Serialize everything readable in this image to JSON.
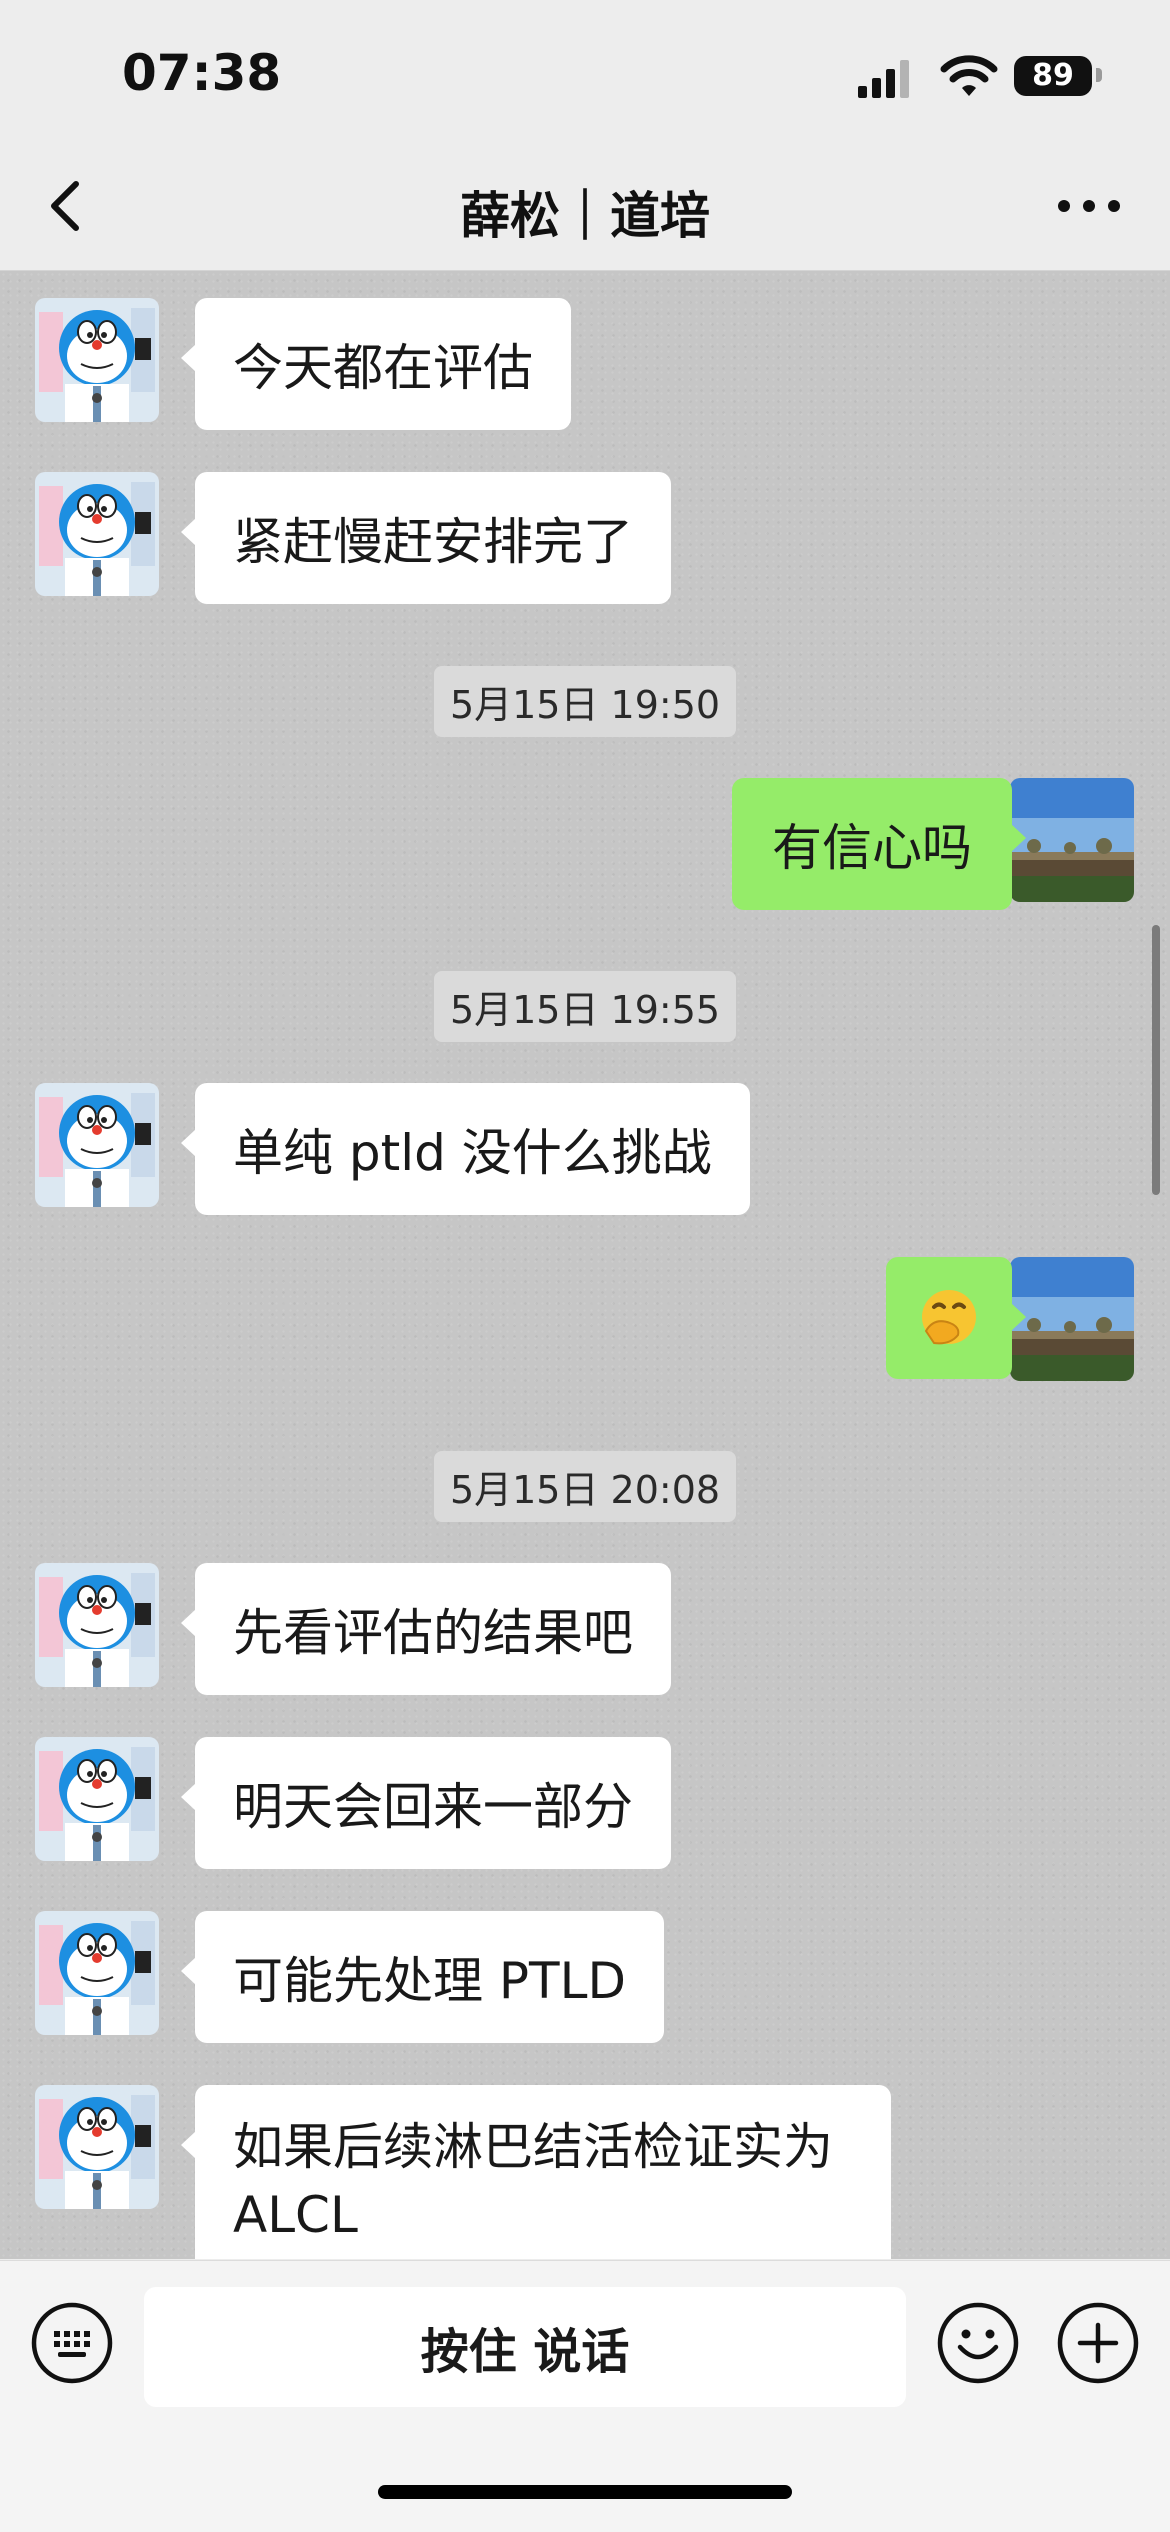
{
  "status_bar": {
    "time": "07:38",
    "battery": "89",
    "icons": [
      "signal-icon",
      "wifi-icon",
      "battery-icon"
    ]
  },
  "nav": {
    "title": "薛松｜道培",
    "back_icon": "chevron-left-icon",
    "more_icon": "more-dots-icon"
  },
  "messages": [
    {
      "type": "incoming",
      "text": "今天都在评估"
    },
    {
      "type": "incoming",
      "text": "紧赶慢赶安排完了"
    },
    {
      "type": "timestamp",
      "text": "5月15日 19:50"
    },
    {
      "type": "outgoing",
      "text": "有信心吗"
    },
    {
      "type": "timestamp",
      "text": "5月15日 19:55"
    },
    {
      "type": "incoming",
      "text": "单纯 ptld 没什么挑战"
    },
    {
      "type": "outgoing",
      "text": "🤭"
    },
    {
      "type": "timestamp",
      "text": "5月15日 20:08"
    },
    {
      "type": "incoming",
      "text": "先看评估的结果吧"
    },
    {
      "type": "incoming",
      "text": "明天会回来一部分"
    },
    {
      "type": "incoming",
      "text": "可能先处理 PTLD"
    },
    {
      "type": "incoming",
      "text": "如果后续淋巴结活检证实为 ALCL"
    }
  ],
  "input_bar": {
    "voice_label": "按住 说话",
    "icons": [
      "keyboard-icon",
      "emoji-icon",
      "plus-icon"
    ]
  },
  "colors": {
    "outgoing_bubble": "#95ec69",
    "incoming_bubble": "#ffffff",
    "chat_background": "#c6c6c6",
    "bar_background": "#ededed"
  }
}
